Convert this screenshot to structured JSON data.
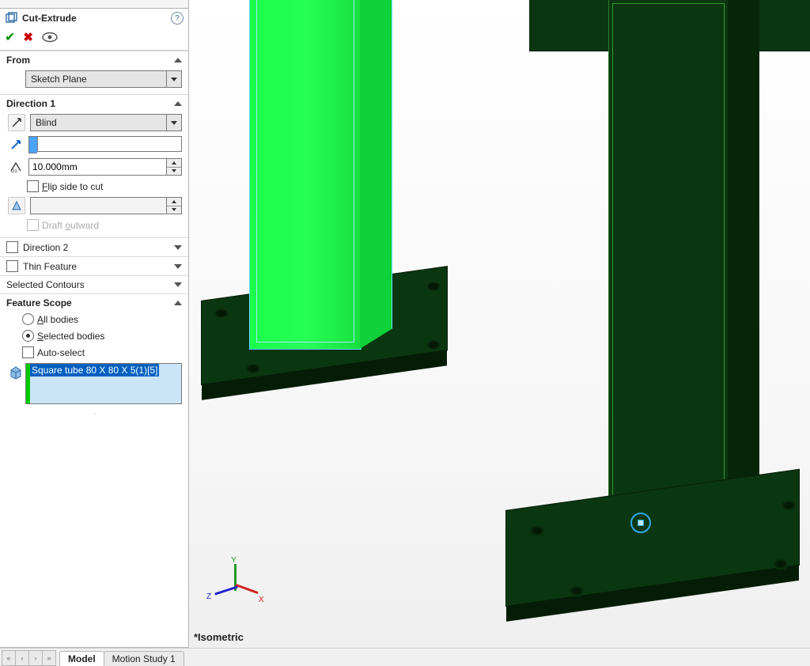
{
  "panel": {
    "title": "Cut-Extrude",
    "help_tooltip": "Help",
    "ok": "OK",
    "cancel": "Cancel"
  },
  "from": {
    "label": "From",
    "value": "Sketch Plane"
  },
  "direction1": {
    "label": "Direction 1",
    "end_condition": "Blind",
    "distance": "10.000mm",
    "color_value": "",
    "flip_label_prefix": "",
    "flip_underline": "F",
    "flip_label_rest": "lip side to cut",
    "draft_label_prefix": "Draft ",
    "draft_underline": "o",
    "draft_label_rest": "utward"
  },
  "direction2": {
    "label": "Direction 2"
  },
  "thin_feature": {
    "label": "Thin Feature"
  },
  "selected_contours": {
    "label": "Selected Contours"
  },
  "feature_scope": {
    "label": "Feature Scope",
    "all_bodies_underline": "A",
    "all_bodies_rest": "ll bodies",
    "selected_bodies_underline": "S",
    "selected_bodies_rest": "elected bodies",
    "auto_select_label": "Auto-select",
    "selected_item": "Square tube 80 X 80 X 5(1)[5]"
  },
  "viewport": {
    "view_label": "*Isometric",
    "triad": {
      "x": "X",
      "y": "Y",
      "z": "Z"
    }
  },
  "tabs": {
    "model": "Model",
    "motion_study": "Motion Study 1"
  }
}
